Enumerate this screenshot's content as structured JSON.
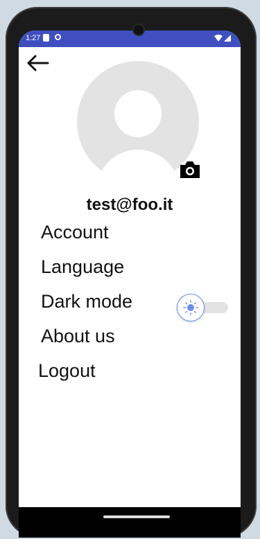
{
  "status_bar": {
    "time": "1:27"
  },
  "profile": {
    "email": "test@foo.it"
  },
  "menu": {
    "items": [
      {
        "label": "Account"
      },
      {
        "label": "Language"
      },
      {
        "label": "Dark mode"
      },
      {
        "label": "About us"
      },
      {
        "label": "Logout"
      }
    ]
  },
  "dark_mode_toggle": {
    "enabled": false
  },
  "icons": {
    "back": "back-arrow-icon",
    "camera": "camera-icon",
    "sun": "sun-icon",
    "avatar": "avatar-placeholder"
  },
  "colors": {
    "status_bar": "#3f4fbf",
    "avatar_bg": "#e3e3e3",
    "toggle_accent": "#6e8cf0"
  }
}
